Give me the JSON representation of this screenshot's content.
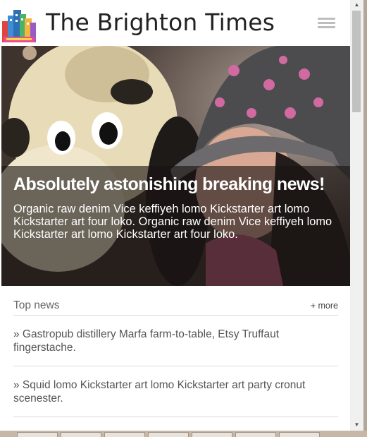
{
  "header": {
    "title": "The Brighton Times",
    "logo_icon": "city-buildings-icon",
    "menu_icon": "hamburger-menu-icon"
  },
  "hero": {
    "headline": "Absolutely astonishing breaking news!",
    "text": "Organic raw denim Vice keffiyeh lomo Kickstarter art lomo Kickstarter art four loko. Organic raw denim Vice keffiyeh lomo Kickstarter art lomo Kickstarter art four loko."
  },
  "top_news": {
    "title": "Top news",
    "more_label": "+ more",
    "items": [
      "» Gastropub distillery Marfa farm-to-table, Etsy Truffaut fingerstache.",
      "» Squid lomo Kickstarter art lomo Kickstarter art party cronut scenester."
    ]
  },
  "scrollbar": {
    "up_icon": "scroll-up-arrow-icon",
    "down_icon": "scroll-down-arrow-icon"
  },
  "colors": {
    "title_text": "#222222",
    "overlay": "#19140f",
    "body_text": "#555555",
    "divider": "#dadada"
  }
}
